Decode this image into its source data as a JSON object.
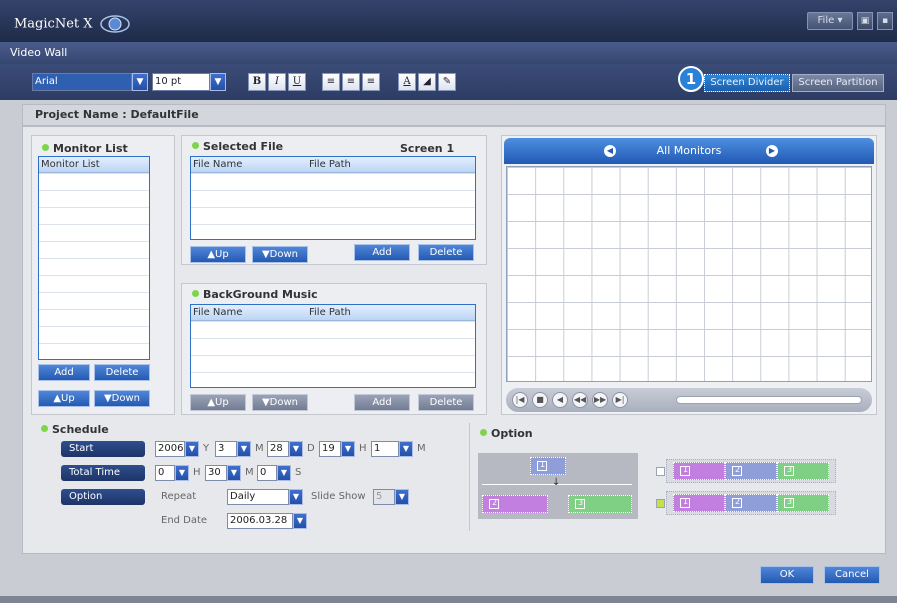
{
  "app": {
    "logo_text": "MagicNet X",
    "window_title": "Video Wall",
    "file_menu": "File ▾"
  },
  "toolbar": {
    "font": "Arial",
    "size": "10 pt",
    "bold": "B",
    "italic": "I",
    "underline": "U",
    "text_color": "A",
    "badge": "1",
    "screen_divider": "Screen Divider",
    "screen_partition": "Screen Partition"
  },
  "project": {
    "label": "Project Name : DefaultFile"
  },
  "monitor_list": {
    "title": "Monitor List",
    "header": "Monitor List",
    "add": "Add",
    "delete": "Delete",
    "up": "▲Up",
    "down": "▼Down"
  },
  "selected_file": {
    "title": "Selected File",
    "screen": "Screen 1",
    "col_name": "File Name",
    "col_path": "File Path",
    "up": "▲Up",
    "down": "▼Down",
    "add": "Add",
    "delete": "Delete"
  },
  "bg_music": {
    "title": "BackGround Music",
    "col_name": "File Name",
    "col_path": "File Path",
    "up": "▲Up",
    "down": "▼Down",
    "add": "Add",
    "delete": "Delete"
  },
  "preview": {
    "title": "All Monitors"
  },
  "schedule": {
    "title": "Schedule",
    "start_label": "Start",
    "year": "2006",
    "y": "Y",
    "month": "3",
    "m": "M",
    "day": "28",
    "d": "D",
    "hour": "19",
    "h": "H",
    "minute": "1",
    "min": "M",
    "total_label": "Total Time",
    "t_h": "0",
    "t_h_unit": "H",
    "t_m": "30",
    "t_m_unit": "M",
    "t_s": "0",
    "t_s_unit": "S",
    "option_label": "Option",
    "repeat_label": "Repeat",
    "repeat_value": "Daily",
    "slideshow_label": "Slide Show",
    "slideshow_value": "5",
    "end_label": "End Date",
    "end_value": "2006.03.28"
  },
  "option": {
    "title": "Option",
    "diagram_cells": [
      "1",
      "2",
      "3"
    ],
    "row1": [
      "1",
      "2",
      "3"
    ],
    "row2": [
      "1",
      "2",
      "3"
    ]
  },
  "footer": {
    "ok": "OK",
    "cancel": "Cancel"
  }
}
